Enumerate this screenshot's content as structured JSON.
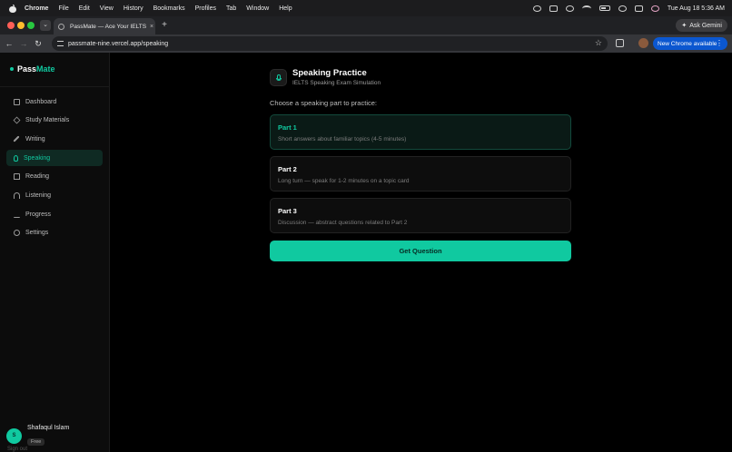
{
  "menubar": {
    "app_name": "Chrome",
    "items": [
      "File",
      "Edit",
      "View",
      "History",
      "Bookmarks",
      "Profiles",
      "Tab",
      "Window",
      "Help"
    ],
    "clock": "Tue Aug 18  5:36 AM"
  },
  "browser": {
    "tab_title": "PassMate — Ace Your IELTS ̶",
    "tab_close": "×",
    "new_tab": "+",
    "ask_gemini": "Ask Gemini",
    "url": "passmate-nine.vercel.app/speaking",
    "new_chrome": "New Chrome available",
    "menu_dots": "⋮"
  },
  "sidebar": {
    "brand_part1": "Pass",
    "brand_part2": "Mate",
    "items": [
      {
        "label": "Dashboard",
        "icon": "dashboard-icon"
      },
      {
        "label": "Study Materials",
        "icon": "graduation-cap-icon"
      },
      {
        "label": "Writing",
        "icon": "pen-icon"
      },
      {
        "label": "Speaking",
        "icon": "mic-icon",
        "active": true
      },
      {
        "label": "Reading",
        "icon": "book-icon"
      },
      {
        "label": "Listening",
        "icon": "headphones-icon"
      },
      {
        "label": "Progress",
        "icon": "bar-chart-icon"
      },
      {
        "label": "Settings",
        "icon": "gear-icon"
      }
    ],
    "user": {
      "initial": "S",
      "name": "Shafaqul Islam",
      "plan": "Free"
    },
    "signout": "Sign out"
  },
  "main": {
    "title": "Speaking Practice",
    "subtitle": "IELTS Speaking Exam Simulation",
    "prompt": "Choose a speaking part to practice:",
    "parts": [
      {
        "title": "Part 1",
        "description": "Short answers about familiar topics (4-5 minutes)",
        "selected": true
      },
      {
        "title": "Part 2",
        "description": "Long turn — speak for 1-2 minutes on a topic card",
        "selected": false
      },
      {
        "title": "Part 3",
        "description": "Discussion — abstract questions related to Part 2",
        "selected": false
      }
    ],
    "button": "Get Question"
  },
  "colors": {
    "accent": "#10c9a0",
    "background": "#000000",
    "sidebar": "#0c0c0c"
  }
}
